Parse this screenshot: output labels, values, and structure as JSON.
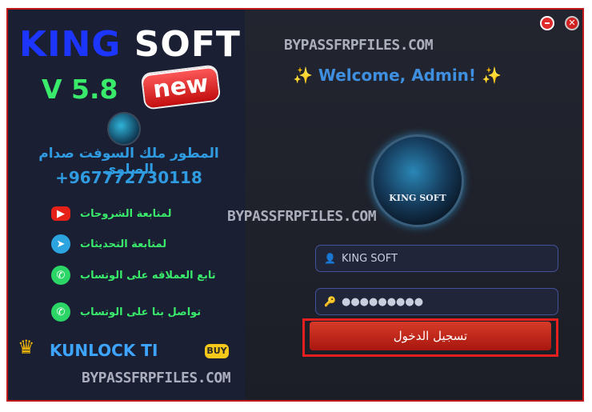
{
  "app": {
    "brand_part1": "KING",
    "brand_part2": " SOFT",
    "version": "V 5.8",
    "new_badge": "new",
    "developer": "المطور ملك السوفت صدام الصلوي",
    "phone": "+967772730118",
    "links": [
      {
        "icon": "youtube-icon",
        "label": "لمتابعة الشروحات"
      },
      {
        "icon": "telegram-icon",
        "label": "لمتابعة التحديثات"
      },
      {
        "icon": "whatsapp-icon",
        "label": "تابع العملاقه على الوتساب"
      },
      {
        "icon": "whatsapp-icon",
        "label": "تواصل بنا على الوتساب"
      }
    ],
    "kunlock": "KUNLOCK TI",
    "buy": "BUY"
  },
  "login": {
    "welcome": "✨ Welcome, Admin! ✨",
    "logo_text": "KING SOFT",
    "username_value": "KING SOFT",
    "password_value": "●●●●●●●●●",
    "login_label": "تسجيل الدخول"
  },
  "watermark": "BYPASSFRPFILES.COM",
  "colors": {
    "accent_blue": "#3f8fe0",
    "accent_green": "#39ea6b",
    "danger_red": "#e81f1f"
  }
}
